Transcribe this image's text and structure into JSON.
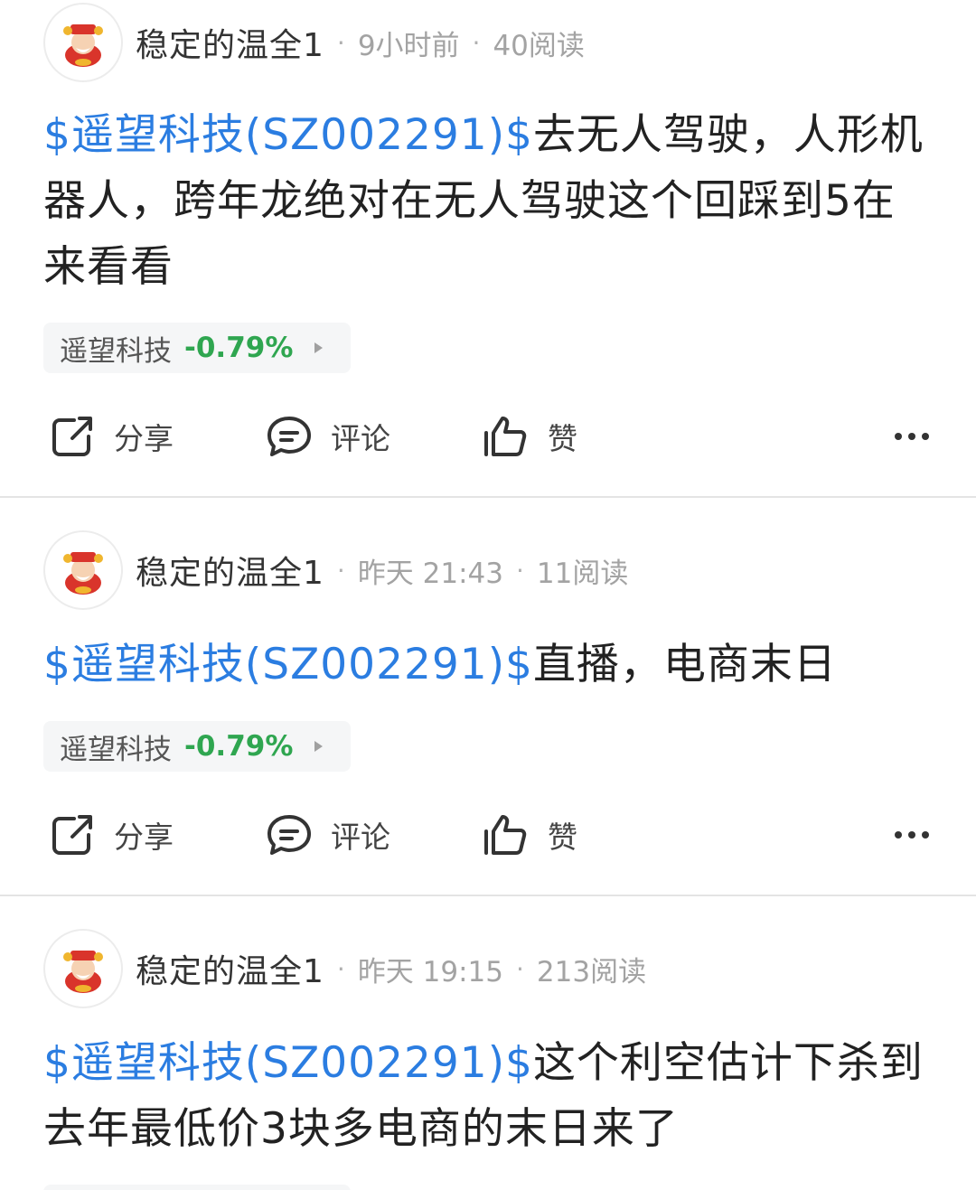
{
  "posts": [
    {
      "author": "稳定的温全1",
      "time": "9小时前",
      "reads": "40阅读",
      "stock_link": "$遥望科技(SZ002291)$",
      "text": "去无人驾驶，人形机器人，跨年龙绝对在无人驾驶这个回踩到5在来看看",
      "chip": {
        "name": "遥望科技",
        "change": "-0.79%"
      },
      "actions": {
        "share": "分享",
        "comment": "评论",
        "like": "赞"
      }
    },
    {
      "author": "稳定的温全1",
      "time": "昨天 21:43",
      "reads": "11阅读",
      "stock_link": "$遥望科技(SZ002291)$",
      "text": "直播，电商末日",
      "chip": {
        "name": "遥望科技",
        "change": "-0.79%"
      },
      "actions": {
        "share": "分享",
        "comment": "评论",
        "like": "赞"
      }
    },
    {
      "author": "稳定的温全1",
      "time": "昨天 19:15",
      "reads": "213阅读",
      "stock_link": "$遥望科技(SZ002291)$",
      "text": "这个利空估计下杀到去年最低价3块多电商的末日来了"
    }
  ],
  "colors": {
    "link": "#2b7de1",
    "down": "#2fa650",
    "meta": "#a3a3a3"
  },
  "icons": {
    "avatar": "god-of-wealth-avatar",
    "share": "share-icon",
    "comment": "comment-icon",
    "like": "thumbs-up-icon",
    "more": "more-icon"
  }
}
